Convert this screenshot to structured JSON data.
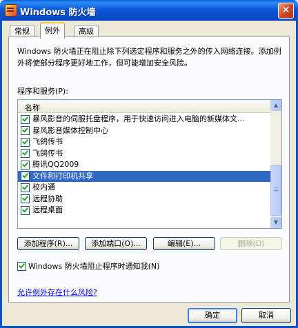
{
  "window": {
    "title": "Windows 防火墙",
    "close_symbol": "✕"
  },
  "tabs": [
    {
      "label": "常规"
    },
    {
      "label": "例外"
    },
    {
      "label": "高级"
    }
  ],
  "exceptions": {
    "description": "Windows 防火墙正在阻止除下列选定程序和服务之外的传入网络连接。添加例外将使部分程序更好地工作，但可能增加安全风险。",
    "list_label": "程序和服务(P):",
    "column_header": "名称",
    "items": [
      {
        "label": "暴风影音的伺服托盘程序，用于快速访问进入电脑的新媒体文...",
        "checked": true
      },
      {
        "label": "暴风影音媒体控制中心",
        "checked": true
      },
      {
        "label": "飞鸽传书",
        "checked": true
      },
      {
        "label": "飞鸽传书",
        "checked": true
      },
      {
        "label": "腾讯QQ2009",
        "checked": true
      },
      {
        "label": "文件和打印机共享",
        "checked": true,
        "selected": true
      },
      {
        "label": "校内通",
        "checked": true
      },
      {
        "label": "远程协助",
        "checked": true
      },
      {
        "label": "远程桌面",
        "checked": true
      }
    ],
    "buttons": {
      "add_program": "添加程序(R)...",
      "add_port": "添加端口(O)...",
      "edit": "编辑(E)...",
      "delete": "删除(D)"
    },
    "notify_label": "Windows 防火墙阻止程序时通知我(N)",
    "notify_checked": true,
    "risk_link": "允许例外存在什么风险?"
  },
  "footer": {
    "ok": "确定",
    "cancel": "取消"
  }
}
